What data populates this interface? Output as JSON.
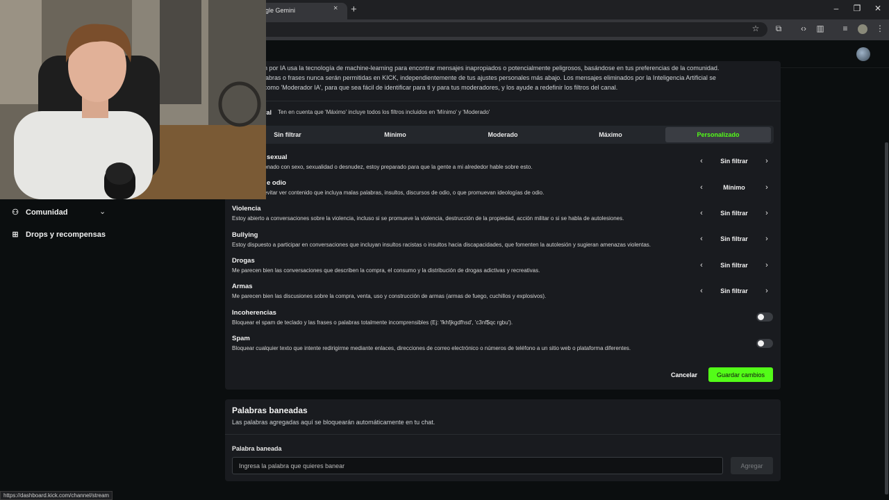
{
  "browser": {
    "tab_title": "gle Gemini",
    "tab_close": "×",
    "new_tab": "+",
    "win_minimize": "–",
    "win_restore": "❐",
    "win_close": "✕",
    "status_url": "https://dashboard.kick.com/channel/stream",
    "toolbar_icons": [
      "star-icon",
      "extensions-icon",
      "devtools-icon",
      "sidebar-icon",
      "media-icon",
      "profile-icon",
      "menu-icon"
    ]
  },
  "sidebar": {
    "items": [
      {
        "label": "Comunidad",
        "icon": "community-icon"
      },
      {
        "label": "Drops y recompensas",
        "icon": "drops-icon"
      }
    ]
  },
  "moderation": {
    "description_lines": [
      "n por IA usa la tecnología de machine-learning para encontrar mensajes inapropiados o potencialmente peligrosos, basándose en tus preferencias de la comunidad.",
      "labras o frases nunca serán permitidas en KICK, independientemente de tus ajustes personales más abajo. Los mensajes eliminados por la Inteligencia Artificial se",
      "como 'Moderador IA', para que sea fácil de identificar para ti y para tus moderadores, y los ayude a redefinir los filtros del canal."
    ],
    "filter_label": "ral",
    "filter_note": "Ten en cuenta que 'Máximo' incluye todos los filtros incluidos en 'Mínimo' y 'Moderado'",
    "levels": [
      "Sin filtrar",
      "Mínimo",
      "Moderado",
      "Máximo",
      "Personalizado"
    ],
    "active_level": "Personalizado",
    "categories": [
      {
        "title": "sexual",
        "desc": "onado con sexo, sexualidad o desnudez, estoy preparado para que la gente a mi alrededor hable sobre esto.",
        "value": "Sin filtrar"
      },
      {
        "title": "e odio",
        "desc": "evitar ver contenido que incluya malas palabras, insultos, discursos de odio, o que promuevan ideologías de odio.",
        "value": "Mínimo"
      },
      {
        "title": "Violencia",
        "desc": "Estoy abierto a conversaciones sobre la violencia, incluso si se promueve la violencia, destrucción de la propiedad, acción militar o si se habla de autolesiones.",
        "value": "Sin filtrar"
      },
      {
        "title": "Bullying",
        "desc": "Estoy dispuesto a participar en conversaciones que incluyan insultos racistas o insultos hacia discapacidades, que fomenten la autolesión y sugieran amenazas violentas.",
        "value": "Sin filtrar"
      },
      {
        "title": "Drogas",
        "desc": "Me parecen bien las conversaciones que describen la compra, el consumo y la distribución de drogas adictivas y recreativas.",
        "value": "Sin filtrar"
      },
      {
        "title": "Armas",
        "desc": "Me parecen bien las discusiones sobre la compra, venta, uso y construcción de armas (armas de fuego, cuchillos y explosivos).",
        "value": "Sin filtrar"
      }
    ],
    "toggles": [
      {
        "title": "Incoherencias",
        "desc": "Bloquear el spam de teclado y las frases o palabras totalmente incomprensibles (Ej: 'fkhfjkgdfhsd', 'c3nf$qc rgbu').",
        "enabled": false
      },
      {
        "title": "Spam",
        "desc": "Bloquear cualquier texto que intente redirigirme mediante enlaces, direcciones de correo electrónico o números de teléfono a un sitio web o plataforma diferentes.",
        "enabled": false
      }
    ],
    "cancel_label": "Cancelar",
    "save_label": "Guardar cambios",
    "arrow_left": "‹",
    "arrow_right": "›"
  },
  "banned_words": {
    "title": "Palabras baneadas",
    "description": "Las palabras agregadas aquí se bloquearán automáticamente en tu chat.",
    "field_label": "Palabra baneada",
    "placeholder": "Ingresa la palabra que quieres banear",
    "add_label": "Agregar"
  },
  "colors": {
    "accent": "#53fc18",
    "panel": "#191b1f",
    "background": "#0b0e0f"
  }
}
